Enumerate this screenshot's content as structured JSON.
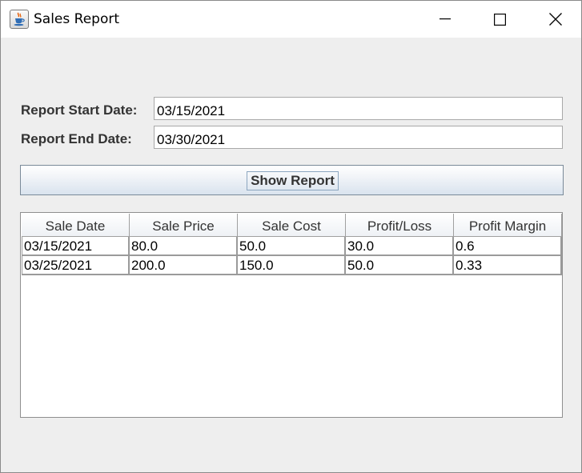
{
  "window": {
    "title": "Sales Report",
    "app_icon": "java-coffee-icon",
    "controls": [
      "minimize-icon",
      "maximize-icon",
      "close-icon"
    ]
  },
  "form": {
    "start_label": "Report Start Date:",
    "start_value": "03/15/2021",
    "end_label": "Report End Date:",
    "end_value": "03/30/2021"
  },
  "show_button": {
    "label": "Show Report"
  },
  "table": {
    "columns": [
      "Sale Date",
      "Sale Price",
      "Sale Cost",
      "Profit/Loss",
      "Profit Margin"
    ],
    "rows": [
      [
        "03/15/2021",
        "80.0",
        "50.0",
        "30.0",
        "0.6"
      ],
      [
        "03/25/2021",
        "200.0",
        "150.0",
        "50.0",
        "0.33"
      ]
    ]
  },
  "colors": {
    "window_bg": "#eeeeee",
    "titlebar_bg": "#ffffff",
    "label_text": "#333333",
    "button_gradient_end": "#d9e3ee"
  }
}
